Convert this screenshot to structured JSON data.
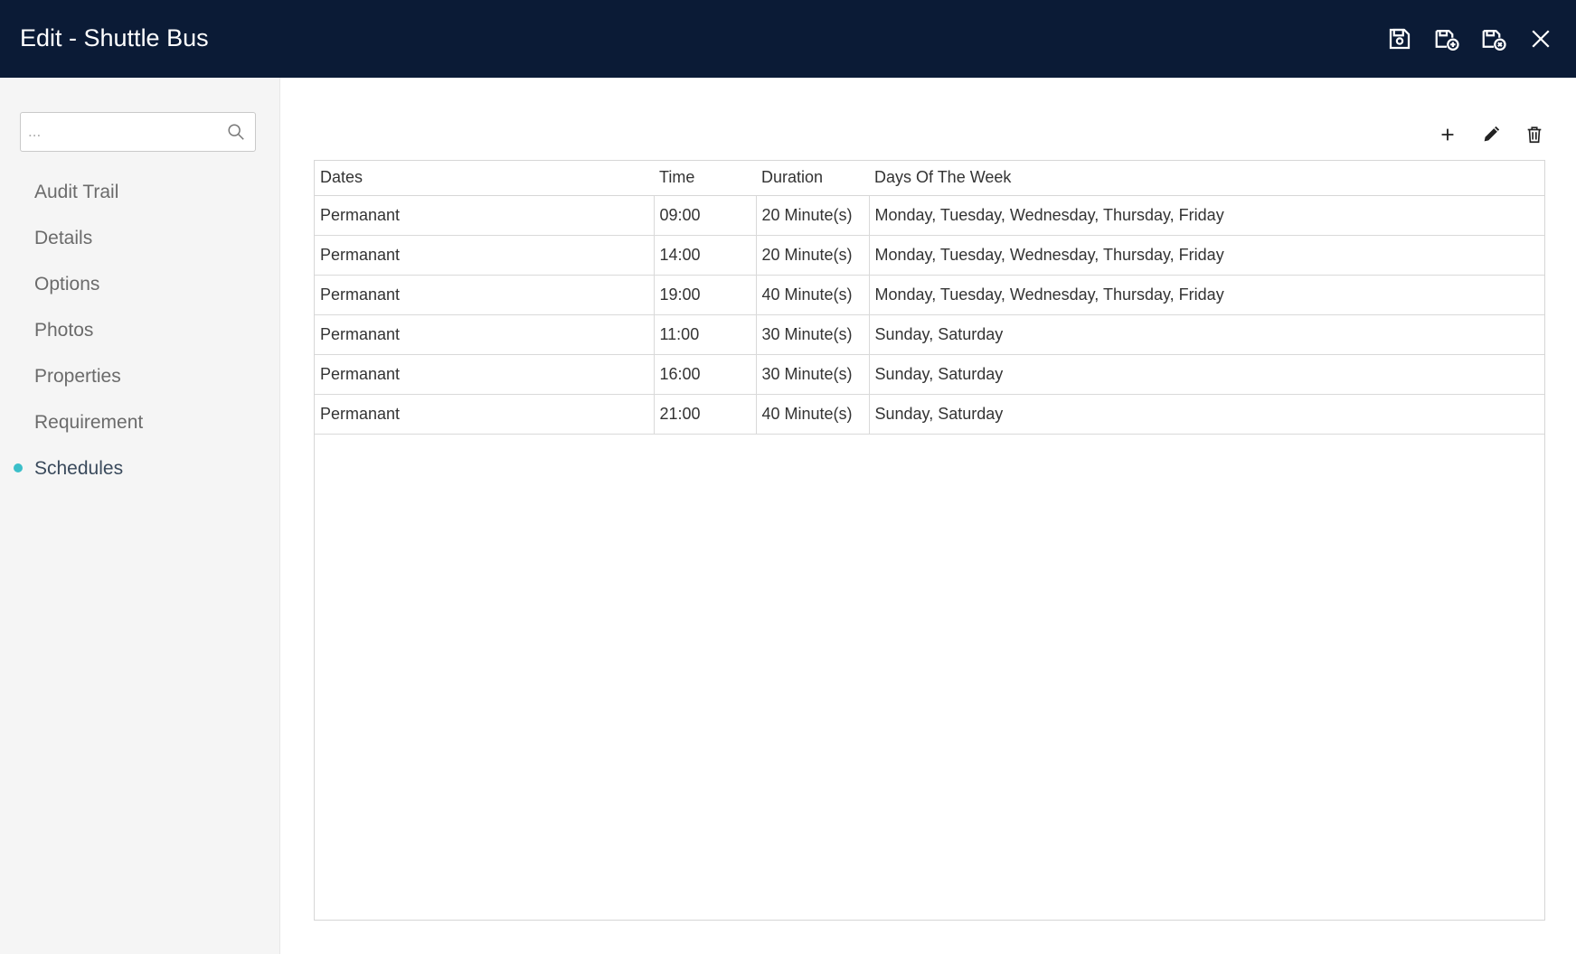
{
  "header": {
    "title": "Edit - Shuttle Bus",
    "actions": [
      {
        "name": "save-icon"
      },
      {
        "name": "save-and-new-icon"
      },
      {
        "name": "save-and-close-icon"
      },
      {
        "name": "close-icon"
      }
    ]
  },
  "sidebar": {
    "search_placeholder": "...",
    "items": [
      {
        "label": "Audit Trail",
        "active": false
      },
      {
        "label": "Details",
        "active": false
      },
      {
        "label": "Options",
        "active": false
      },
      {
        "label": "Photos",
        "active": false
      },
      {
        "label": "Properties",
        "active": false
      },
      {
        "label": "Requirement",
        "active": false
      },
      {
        "label": "Schedules",
        "active": true
      }
    ]
  },
  "toolbar": {
    "icons": [
      "add-icon",
      "edit-icon",
      "delete-icon"
    ]
  },
  "table": {
    "columns": [
      "Dates",
      "Time",
      "Duration",
      "Days Of The Week"
    ],
    "rows": [
      [
        "Permanant",
        "09:00",
        "20 Minute(s)",
        "Monday, Tuesday, Wednesday, Thursday, Friday"
      ],
      [
        "Permanant",
        "14:00",
        "20 Minute(s)",
        "Monday, Tuesday, Wednesday, Thursday, Friday"
      ],
      [
        "Permanant",
        "19:00",
        "40 Minute(s)",
        "Monday, Tuesday, Wednesday, Thursday, Friday"
      ],
      [
        "Permanant",
        "11:00",
        "30 Minute(s)",
        "Sunday, Saturday"
      ],
      [
        "Permanant",
        "16:00",
        "30 Minute(s)",
        "Sunday, Saturday"
      ],
      [
        "Permanant",
        "21:00",
        "40 Minute(s)",
        "Sunday, Saturday"
      ]
    ]
  },
  "colors": {
    "header_bg": "#0b1b36",
    "active_dot": "#3bbfc9",
    "sidebar_bg": "#f5f5f5"
  }
}
